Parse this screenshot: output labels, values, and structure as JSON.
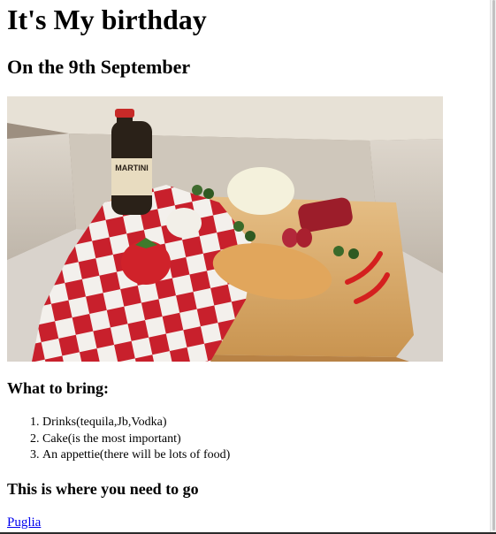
{
  "page": {
    "title": "It's My birthday",
    "subtitle": "On the 9th September",
    "bring_heading": "What to bring:",
    "bring_items": [
      "Drinks(tequila,Jb,Vodka)",
      "Cake(is the most important)",
      "An appettie(there will be lots of food)"
    ],
    "where_heading": "This is where you need to go",
    "location_link": "Puglia"
  },
  "image": {
    "label": "MARTINI"
  }
}
